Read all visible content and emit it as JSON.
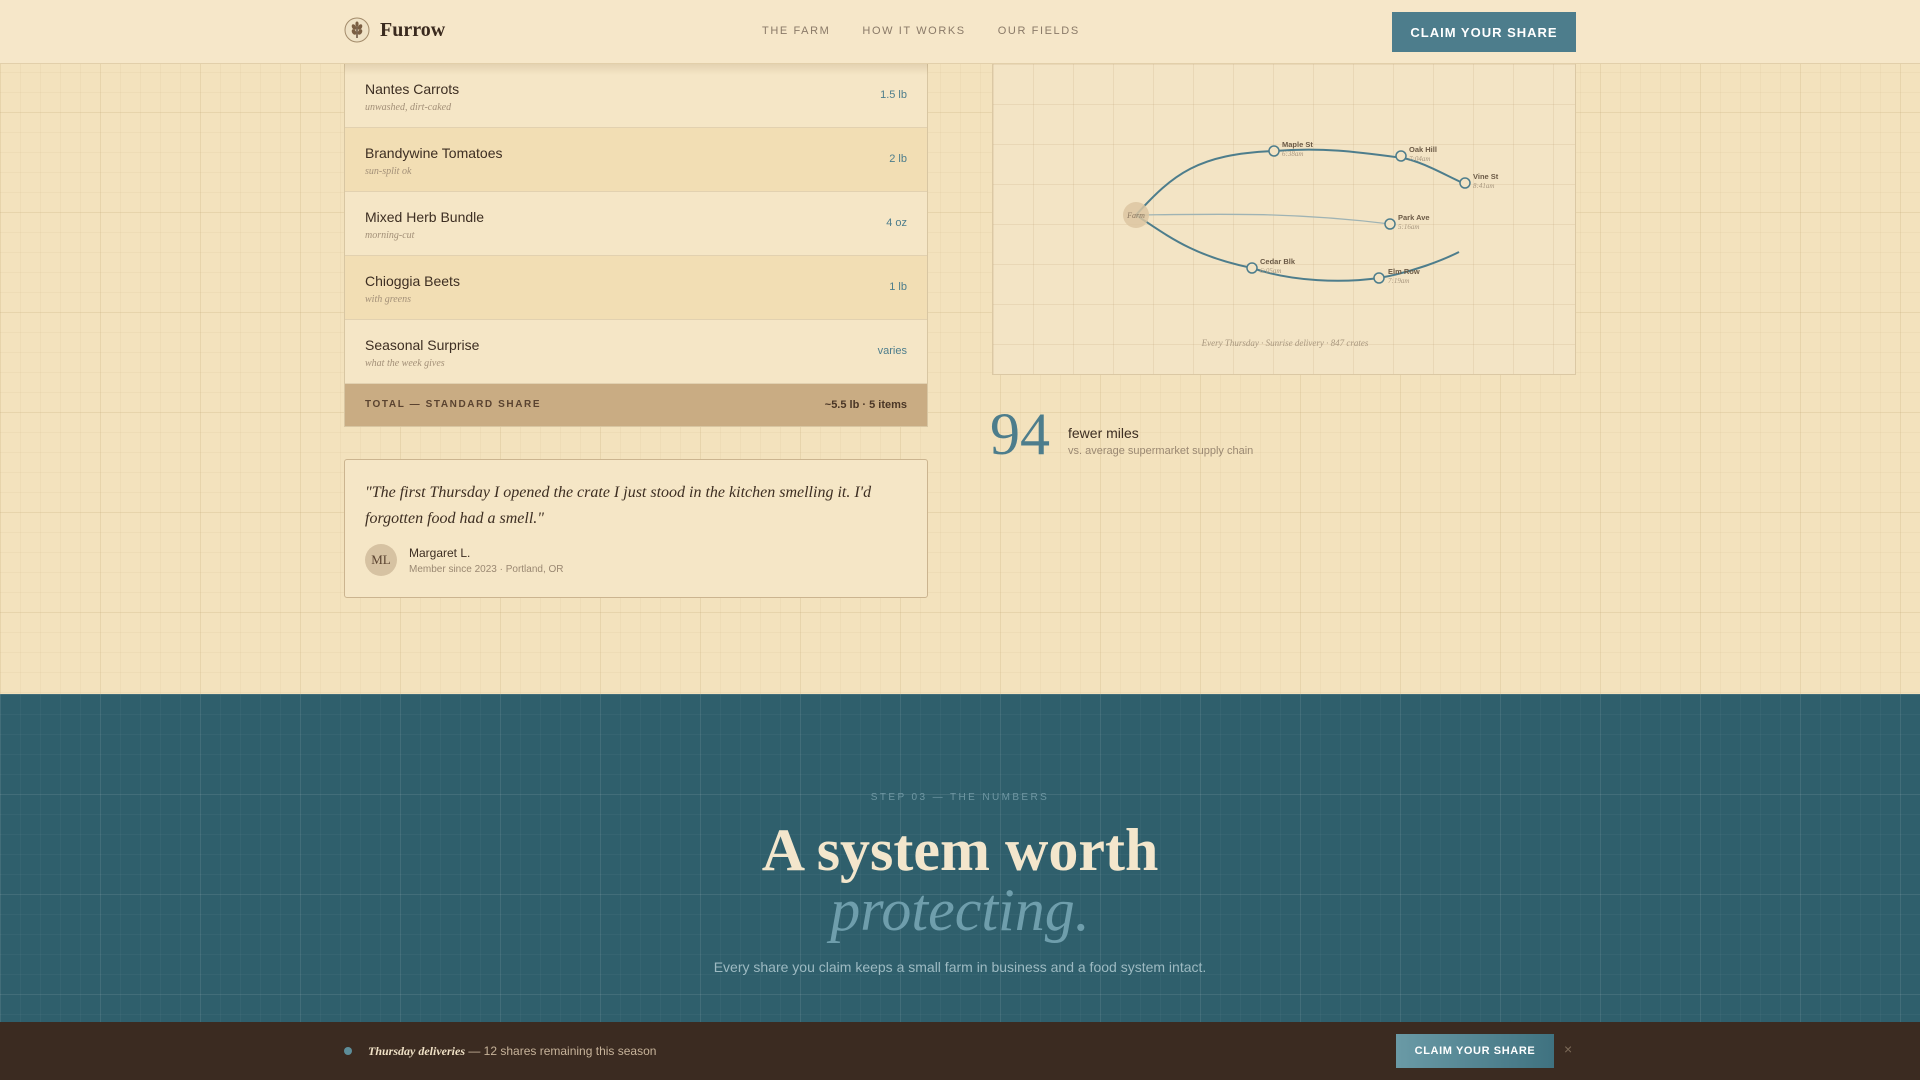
{
  "header": {
    "brand": "Furrow",
    "nav": [
      "THE FARM",
      "HOW IT WORKS",
      "OUR FIELDS"
    ],
    "cta": "CLAIM YOUR SHARE"
  },
  "produce": {
    "items": [
      {
        "name": "Nantes Carrots",
        "note": "unwashed, dirt-caked",
        "qty": "1.5 lb"
      },
      {
        "name": "Brandywine Tomatoes",
        "note": "sun-split ok",
        "qty": "2 lb"
      },
      {
        "name": "Mixed Herb Bundle",
        "note": "morning-cut",
        "qty": "4 oz"
      },
      {
        "name": "Chioggia Beets",
        "note": "with greens",
        "qty": "1 lb"
      },
      {
        "name": "Seasonal Surprise",
        "note": "what the week gives",
        "qty": "varies"
      }
    ],
    "total_label": "TOTAL — STANDARD SHARE",
    "total_value": "~5.5 lb · 5 items"
  },
  "testimonial": {
    "quote": "\"The first Thursday I opened the crate I just stood in the kitchen smelling it. I'd forgotten food had a smell.\"",
    "initials": "ML",
    "author": "Margaret L.",
    "meta": "Member since 2023 · Portland, OR"
  },
  "route_map": {
    "origin": "Farm",
    "stops": [
      {
        "name": "Maple St",
        "time": "6:38am"
      },
      {
        "name": "Oak Hill",
        "time": "7:04am"
      },
      {
        "name": "Vine St",
        "time": "8:41am"
      },
      {
        "name": "Park Ave",
        "time": "5:16am"
      },
      {
        "name": "Cedar Blk",
        "time": "6:05am"
      },
      {
        "name": "Elm Row",
        "time": "7:19am"
      }
    ],
    "caption": "Every Thursday · Sunrise delivery · 847 crates"
  },
  "stat": {
    "number": "94",
    "label": "fewer miles",
    "sub": "vs. average supermarket supply chain"
  },
  "numbers_section": {
    "eyebrow": "STEP 03 — THE NUMBERS",
    "headline": "A system worth",
    "headline_accent": "protecting.",
    "sub": "Every share you claim keeps a small farm in business and a food system intact."
  },
  "bottom_bar": {
    "highlight": "Thursday deliveries",
    "text": " — 12 shares remaining this season",
    "cta": "CLAIM YOUR SHARE",
    "close": "×"
  },
  "colors": {
    "accent": "#4d7d8c",
    "cream": "#f3e2bd",
    "teal_section": "#2f5f6c",
    "dark_bar": "#3b2b21",
    "total_band": "#c9ac83"
  }
}
